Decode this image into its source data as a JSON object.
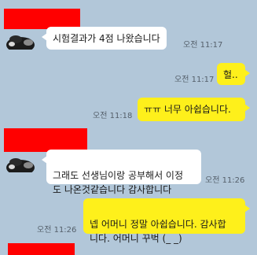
{
  "colors": {
    "background": "#b2c7d9",
    "incoming_bubble": "#ffffff",
    "outgoing_bubble": "#fef01b",
    "redaction": "#ff0000"
  },
  "messages": [
    {
      "direction": "incoming",
      "text": "시험결과가 4점  나왔습니다",
      "time": "오전 11:17"
    },
    {
      "direction": "outgoing",
      "text": "헐..",
      "time": "오전 11:17"
    },
    {
      "direction": "outgoing",
      "text": "ㅠㅠ 너무 아쉽습니다.",
      "time": "오전 11:18"
    },
    {
      "direction": "incoming",
      "text": "그래도 선생님이랑 공부해서 이정\n도 나온것같습니다  감사합니다",
      "time": "오전 11:26"
    },
    {
      "direction": "outgoing",
      "text": "넵 어머니 정말 아쉽습니다. 감사합\n니다. 어머니 꾸벅 (_ _)",
      "time": "오전 11:26"
    }
  ]
}
